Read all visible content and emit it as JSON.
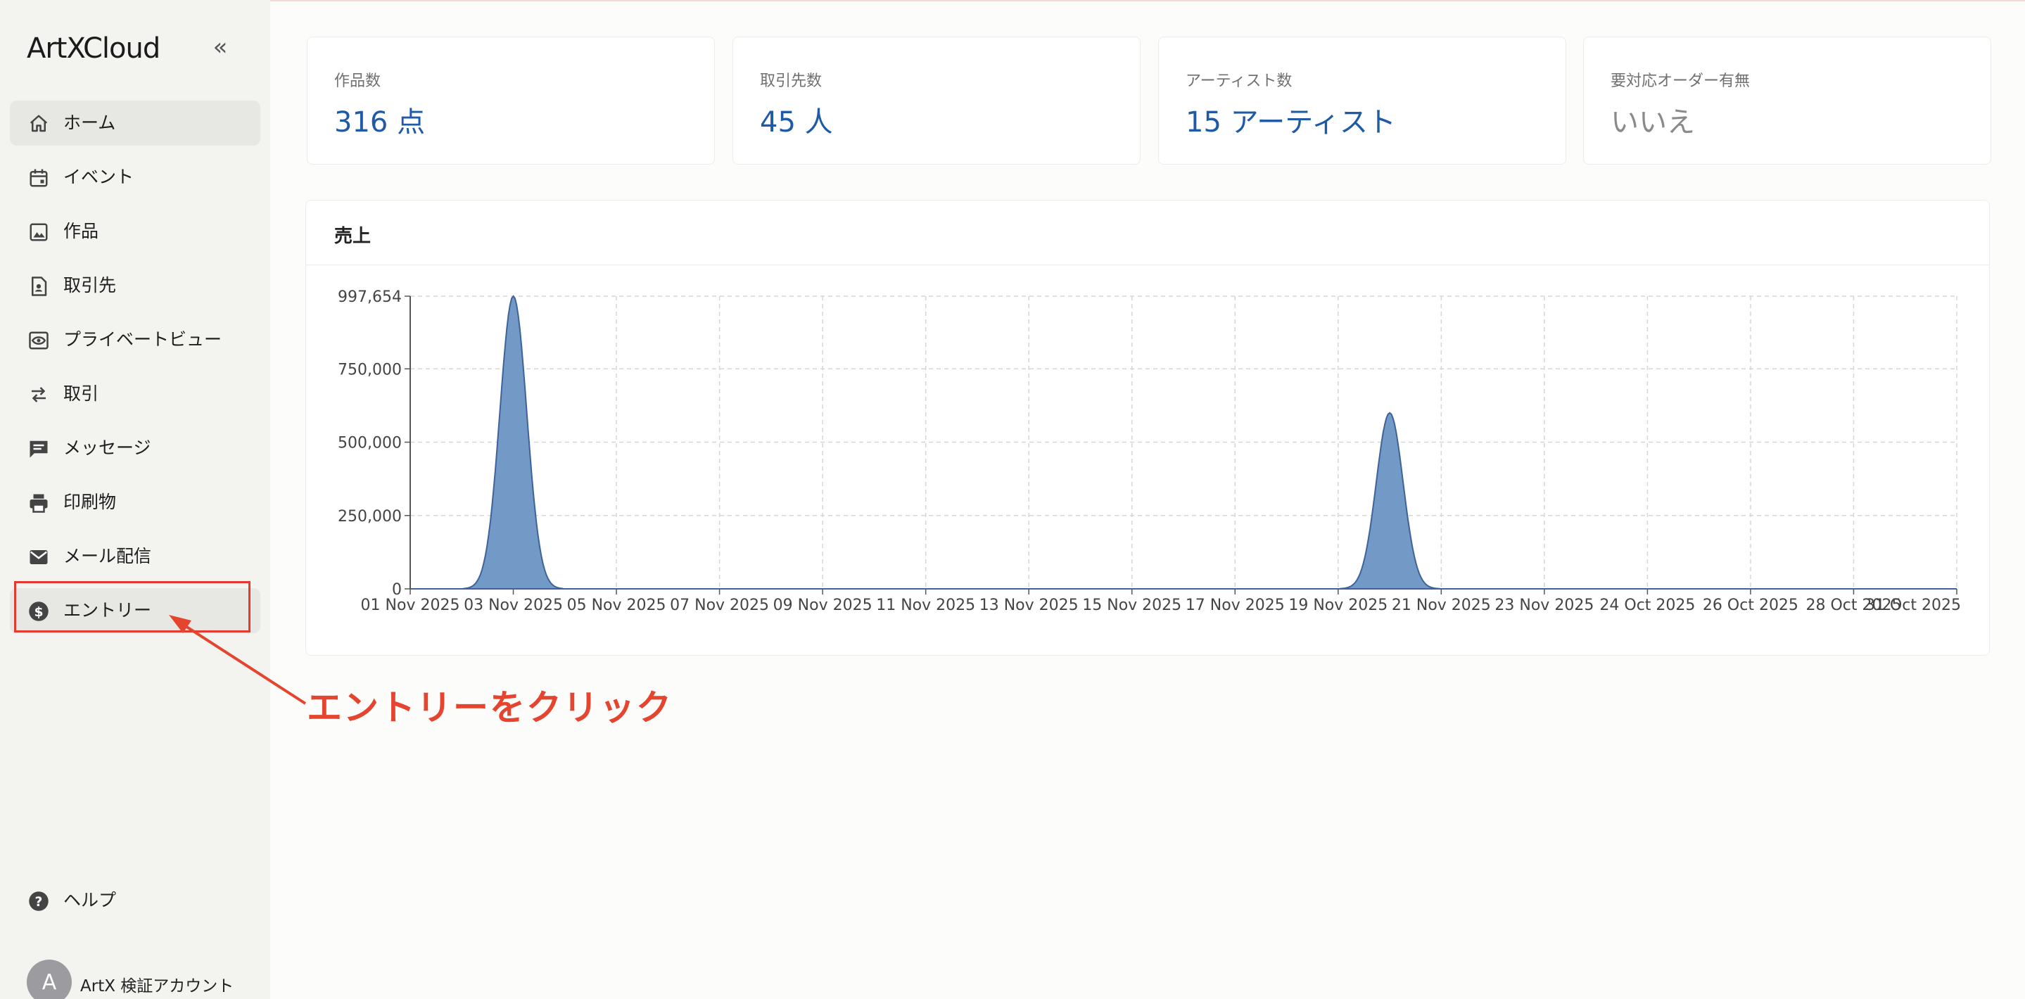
{
  "app": {
    "logo": "ArtXCloud",
    "collapse_icon": "double-chevron-left-icon"
  },
  "sidebar": {
    "items": [
      {
        "label": "ホーム",
        "icon": "home-icon",
        "active": true
      },
      {
        "label": "イベント",
        "icon": "calendar-icon"
      },
      {
        "label": "作品",
        "icon": "image-icon"
      },
      {
        "label": "取引先",
        "icon": "contact-icon"
      },
      {
        "label": "プライベートビュー",
        "icon": "eye-icon"
      },
      {
        "label": "取引",
        "icon": "swap-icon"
      },
      {
        "label": "メッセージ",
        "icon": "message-icon"
      },
      {
        "label": "印刷物",
        "icon": "printer-icon"
      },
      {
        "label": "メール配信",
        "icon": "mail-icon"
      },
      {
        "label": "エントリー",
        "icon": "dollar-icon",
        "highlighted": true
      }
    ],
    "help": {
      "label": "ヘルプ",
      "icon": "help-icon"
    },
    "account": {
      "avatar": "A",
      "name": "ArtX 検証アカウント"
    }
  },
  "stats": [
    {
      "label": "作品数",
      "value": "316 点"
    },
    {
      "label": "取引先数",
      "value": "45 人"
    },
    {
      "label": "アーティスト数",
      "value": "15 アーティスト"
    },
    {
      "label": "要対応オーダー有無",
      "value": "いいえ",
      "muted": true
    }
  ],
  "sales": {
    "title": "売上",
    "chart_data": {
      "type": "area",
      "title": "売上",
      "x": [
        "01 Nov 2025",
        "03 Nov 2025",
        "05 Nov 2025",
        "07 Nov 2025",
        "09 Nov 2025",
        "11 Nov 2025",
        "13 Nov 2025",
        "15 Nov 2025",
        "17 Nov 2025",
        "19 Nov 2025",
        "21 Nov 2025",
        "23 Nov 2025",
        "24 Oct 2025",
        "26 Oct 2025",
        "28 Oct 2025",
        "31 Oct 2025"
      ],
      "series": [
        {
          "values": [
            0,
            997654,
            0,
            0,
            0,
            0,
            0,
            0,
            0,
            0,
            600000,
            0,
            0,
            0,
            0,
            0
          ]
        }
      ],
      "peaks": [
        {
          "x_between": [
            "03 Nov 2025"
          ],
          "value": 997654
        },
        {
          "x_between": [
            "19 Nov 2025",
            "21 Nov 2025"
          ],
          "value": 600000
        }
      ],
      "yticks": [
        "0",
        "250,000",
        "500,000",
        "750,000",
        "997,654"
      ],
      "ylim": [
        0,
        997654
      ],
      "grid": true,
      "color": "#7399c6",
      "stroke": "#3d639a"
    }
  },
  "annotation": {
    "text": "エントリーをクリック",
    "color": "#e5452e"
  }
}
